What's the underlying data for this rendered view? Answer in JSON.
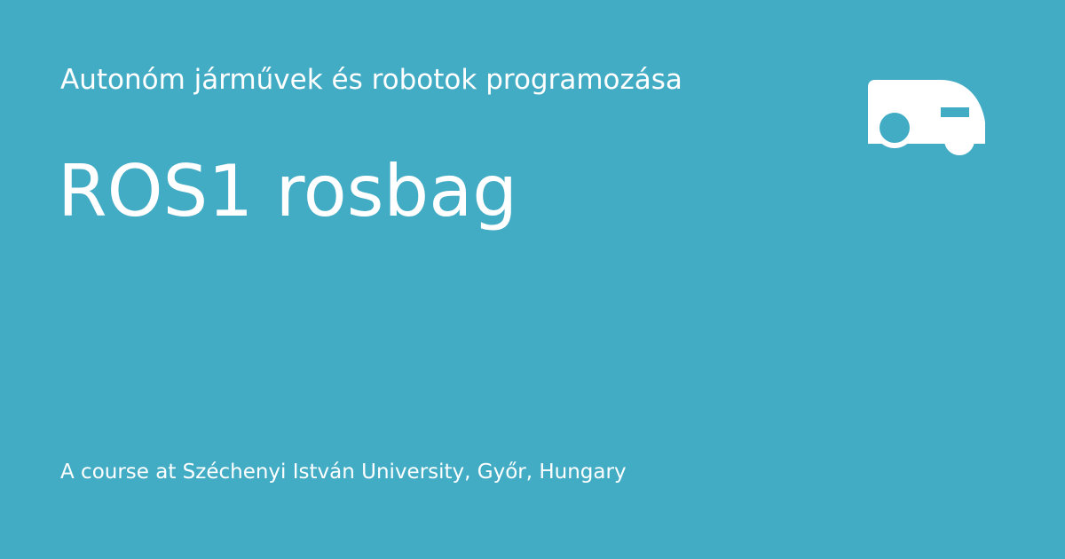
{
  "colors": {
    "background": "#43acc5",
    "foreground": "#ffffff"
  },
  "header": {
    "site_name": "Autonóm járművek és robotok programozása",
    "logo_icon": "vehicle-icon"
  },
  "main": {
    "title": "ROS1 rosbag"
  },
  "footer": {
    "text": "A course at Széchenyi István University, Győr, Hungary"
  }
}
